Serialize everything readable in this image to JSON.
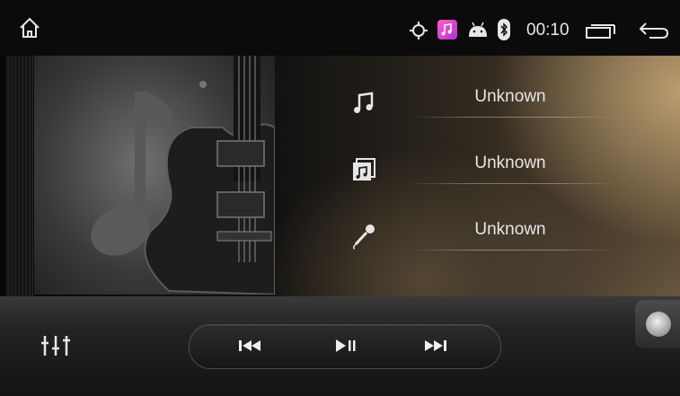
{
  "statusbar": {
    "time": "00:10",
    "icons": [
      "home-icon",
      "gps-icon",
      "music-app-icon",
      "android-icon",
      "bluetooth-icon",
      "recents-icon",
      "back-icon"
    ],
    "music_icon_color": "#e23fd1"
  },
  "track_info": {
    "title": "Unknown",
    "album": "Unknown",
    "artist": "Unknown"
  },
  "controls": {
    "icons": [
      "equalizer-icon",
      "previous-icon",
      "play-pause-icon",
      "next-icon"
    ]
  }
}
